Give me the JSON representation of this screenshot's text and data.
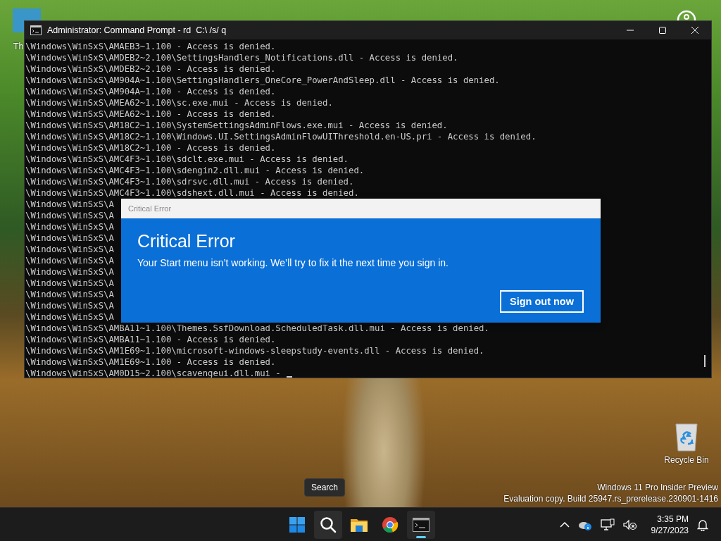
{
  "desktop_icons": [
    {
      "label": "Th"
    }
  ],
  "console": {
    "title": "Administrator: Command Prompt - rd  C:\\ /s/ q",
    "lines": [
      {
        "text": "\\Windows\\WinSxS\\AMAEB3~1.100 - Access is denied."
      },
      {
        "text": "\\Windows\\WinSxS\\AMDEB2~2.100\\SettingsHandlers_Notifications.dll - Access is denied."
      },
      {
        "text": "\\Windows\\WinSxS\\AMDEB2~2.100 - Access is denied."
      },
      {
        "text": "\\Windows\\WinSxS\\AM904A~1.100\\SettingsHandlers_OneCore_PowerAndSleep.dll - Access is denied."
      },
      {
        "text": "\\Windows\\WinSxS\\AM904A~1.100 - Access is denied."
      },
      {
        "text": "\\Windows\\WinSxS\\AMEA62~1.100\\sc.exe.mui - Access is denied."
      },
      {
        "text": "\\Windows\\WinSxS\\AMEA62~1.100 - Access is denied."
      },
      {
        "text": "\\Windows\\WinSxS\\AM18C2~1.100\\SystemSettingsAdminFlows.exe.mui - Access is denied."
      },
      {
        "text": "\\Windows\\WinSxS\\AM18C2~1.100\\Windows.UI.SettingsAdminFlowUIThreshold.en-US.pri - Access is denied."
      },
      {
        "text": "\\Windows\\WinSxS\\AM18C2~1.100 - Access is denied."
      },
      {
        "text": "\\Windows\\WinSxS\\AMC4F3~1.100\\sdclt.exe.mui - Access is denied."
      },
      {
        "text": "\\Windows\\WinSxS\\AMC4F3~1.100\\sdengin2.dll.mui - Access is denied."
      },
      {
        "text": "\\Windows\\WinSxS\\AMC4F3~1.100\\sdrsvc.dll.mui - Access is denied."
      },
      {
        "text": "\\Windows\\WinSxS\\AMC4F3~1.100\\sdshext.dll.mui - Access is denied."
      },
      {
        "text": "\\Windows\\WinSxS\\A"
      },
      {
        "text": "\\Windows\\WinSxS\\A"
      },
      {
        "text": "\\Windows\\WinSxS\\A"
      },
      {
        "text": "\\Windows\\WinSxS\\A"
      },
      {
        "text": "\\Windows\\WinSxS\\A"
      },
      {
        "text": "\\Windows\\WinSxS\\A"
      },
      {
        "text": "\\Windows\\WinSxS\\A"
      },
      {
        "text": "\\Windows\\WinSxS\\A"
      },
      {
        "text": "\\Windows\\WinSxS\\A"
      },
      {
        "text": "\\Windows\\WinSxS\\A"
      },
      {
        "text": "\\Windows\\WinSxS\\A"
      },
      {
        "text": "\\Windows\\WinSxS\\AMBA11~1.100\\Themes.SsfDownload.ScheduledTask.dll.mui - Access is denied."
      },
      {
        "text": "\\Windows\\WinSxS\\AMBA11~1.100 - Access is denied."
      },
      {
        "text": "\\Windows\\WinSxS\\AM1E69~1.100\\microsoft-windows-sleepstudy-events.dll - Access is denied."
      },
      {
        "text": "\\Windows\\WinSxS\\AM1E69~1.100 - Access is denied."
      },
      {
        "text": "\\Windows\\WinSxS\\AM0D15~2.100\\scavengeui.dll.mui -"
      }
    ]
  },
  "dialog": {
    "caption": "Critical Error",
    "heading": "Critical Error",
    "message": "Your Start menu isn’t working. We’ll try to fix it the next time you sign in.",
    "button": "Sign out now"
  },
  "recycle_bin": {
    "label": "Recycle Bin"
  },
  "system_notice": [
    "Windows 11 Pro Insider Preview",
    "Evaluation copy. Build 25947.rs_prerelease.230901-1416"
  ],
  "tooltip": "Search",
  "taskbar": {
    "apps": [
      {
        "kind": "start",
        "hovered": false,
        "active": false
      },
      {
        "kind": "search",
        "hovered": true,
        "active": false
      },
      {
        "kind": "folder",
        "hovered": false,
        "active": false
      },
      {
        "kind": "browser",
        "hovered": false,
        "active": false
      },
      {
        "kind": "terminal",
        "hovered": false,
        "active": true
      }
    ],
    "time": "3:35 PM",
    "date": "9/27/2023"
  }
}
